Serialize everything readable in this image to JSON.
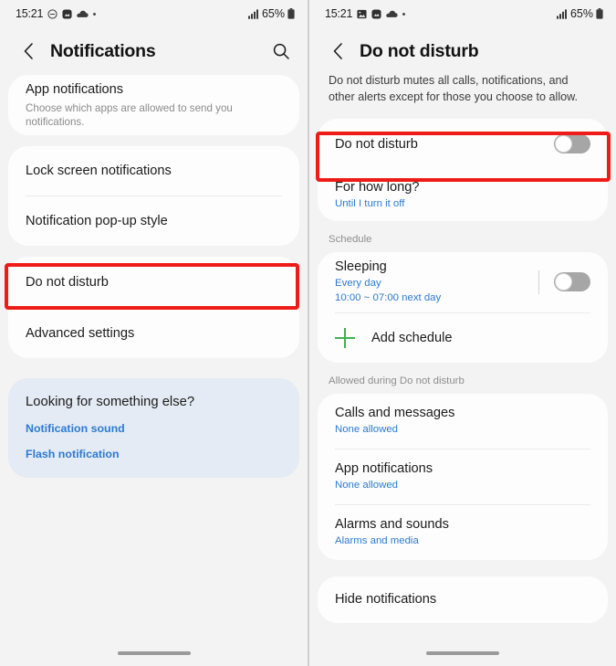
{
  "left": {
    "statusbar": {
      "time": "15:21",
      "icons": [
        "dnd-minus-circle-icon",
        "gallery-icon",
        "cloud-icon",
        "dot-icon"
      ],
      "signal": "signal-bars-icon",
      "battery_percent": "65%",
      "battery_icon": "battery-icon"
    },
    "header": {
      "back_icon": "back-chevron-icon",
      "title": "Notifications",
      "search_icon": "search-icon"
    },
    "card1": {
      "rows": [
        {
          "title": "App notifications",
          "sub": "Choose which apps are allowed to send you notifications."
        }
      ]
    },
    "card2": {
      "rows": [
        {
          "title": "Lock screen notifications"
        },
        {
          "title": "Notification pop-up style"
        }
      ]
    },
    "card3": {
      "rows": [
        {
          "title": "Do not disturb"
        },
        {
          "title": "Advanced settings"
        }
      ]
    },
    "suggest": {
      "title": "Looking for something else?",
      "links": [
        "Notification sound",
        "Flash notification"
      ]
    }
  },
  "right": {
    "statusbar": {
      "time": "15:21",
      "icons": [
        "image-icon",
        "gallery-icon",
        "cloud-icon",
        "dot-icon"
      ],
      "signal": "signal-bars-icon",
      "battery_percent": "65%",
      "battery_icon": "battery-icon"
    },
    "header": {
      "back_icon": "back-chevron-icon",
      "title": "Do not disturb"
    },
    "description": "Do not disturb mutes all calls, notifications, and other alerts except for those you choose to allow.",
    "main_card": {
      "dnd": {
        "title": "Do not disturb",
        "toggle_on": false
      },
      "how_long": {
        "title": "For how long?",
        "sub": "Until I turn it off"
      }
    },
    "schedule": {
      "label": "Schedule",
      "sleeping": {
        "title": "Sleeping",
        "sub1": "Every day",
        "sub2": "10:00 ~ 07:00 next day",
        "toggle_on": false
      },
      "add": {
        "label": "Add schedule",
        "icon": "plus-icon"
      }
    },
    "allowed": {
      "label": "Allowed during Do not disturb",
      "rows": [
        {
          "title": "Calls and messages",
          "sub": "None allowed"
        },
        {
          "title": "App notifications",
          "sub": "None allowed"
        },
        {
          "title": "Alarms and sounds",
          "sub": "Alarms and media"
        }
      ]
    },
    "hide_card": {
      "rows": [
        {
          "title": "Hide notifications"
        }
      ]
    }
  },
  "colors": {
    "highlight": "#ee1b18",
    "link_blue": "#2d7ad1",
    "accent_green": "#3fb152",
    "suggest_bg": "#e4ebf4"
  }
}
